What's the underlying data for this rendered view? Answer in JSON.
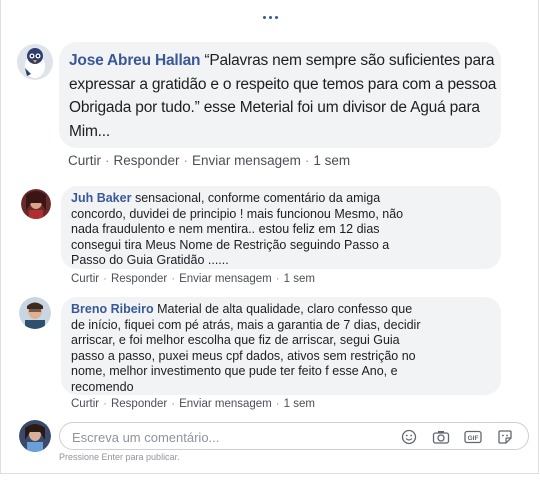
{
  "comments": [
    {
      "name": "Jose Abreu Hallan",
      "lines": [
        "“Palavras nem sempre são suficientes para",
        "expressar a gratidão e o respeito que temos para com a pessoa",
        "Obrigada por tudo.” esse Meterial foi um divisor de Aguá para",
        "Mim..."
      ],
      "actions": [
        "Curtir",
        "Responder",
        "Enviar mensagem",
        "1 sem"
      ]
    },
    {
      "name": "Juh Baker",
      "lines": [
        "sensacional, conforme comentário da amiga",
        "concordo, duvidei de principio ! mais funcionou Mesmo, não",
        "nada fraudulento e nem mentira.. estou feliz em 12 dias",
        "consegui tira Meus Nome de Restrição seguindo Passo a",
        "Passo do Guia Gratidão ......"
      ],
      "actions": [
        "Curtir",
        "Responder",
        "Enviar mensagem",
        "1 sem"
      ]
    },
    {
      "name": "Breno Ribeiro",
      "lines": [
        "Material de alta qualidade, claro confesso que",
        "de início, fiquei com pé atrás, mais a garantia de 7 dias, decidir",
        "arriscar, e foi melhor escolha que fiz de arriscar, segui Guia",
        "passo a passo, puxei meus cpf dados, ativos sem restrição no",
        "nome, melhor investimento que pude ter feito f esse Ano, e",
        "recomendo"
      ],
      "actions": [
        "Curtir",
        "Responder",
        "Enviar mensagem",
        "1 sem"
      ]
    }
  ],
  "composer": {
    "placeholder": "Escreva um comentário...",
    "hint": "Pressione Enter para publicar.",
    "tools": [
      "emoji-icon",
      "camera-icon",
      "gif-icon",
      "sticker-icon"
    ]
  },
  "colors": {
    "link": "#385898",
    "bubble": "#f2f3f5",
    "meta": "#4b4f56"
  }
}
